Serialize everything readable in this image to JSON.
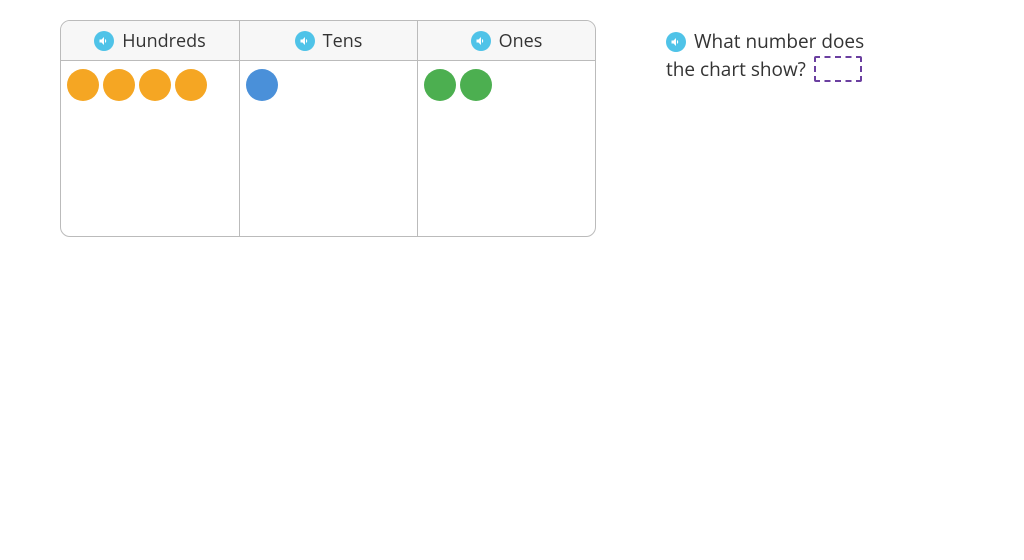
{
  "placeValue": {
    "columns": [
      {
        "label": "Hundreds",
        "count": 4,
        "colorClass": "dot-hundreds"
      },
      {
        "label": "Tens",
        "count": 1,
        "colorClass": "dot-tens"
      },
      {
        "label": "Ones",
        "count": 2,
        "colorClass": "dot-ones"
      }
    ]
  },
  "question": {
    "line1": "What number does",
    "line2": "the chart show?",
    "answerValue": ""
  }
}
